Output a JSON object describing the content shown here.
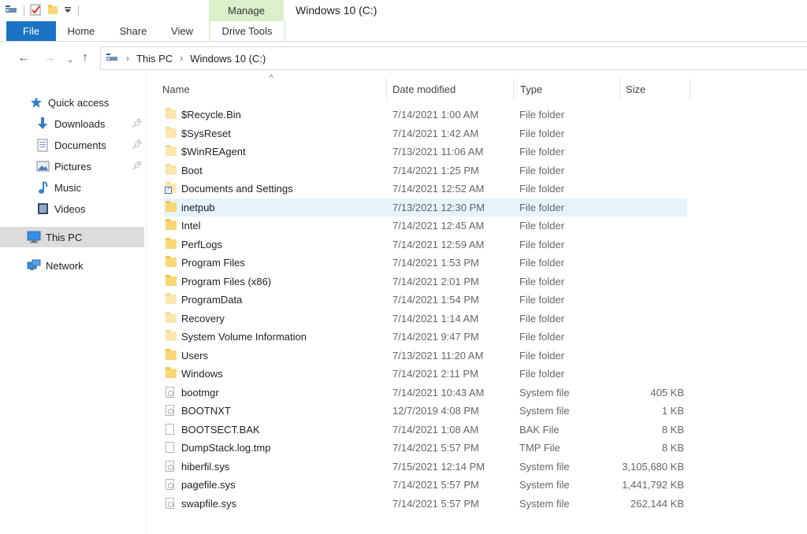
{
  "window": {
    "title": "Windows 10 (C:)"
  },
  "ribbon": {
    "context_group": "Manage",
    "tabs": [
      "File",
      "Home",
      "Share",
      "View",
      "Drive Tools"
    ]
  },
  "nav": {
    "path": [
      "This PC",
      "Windows 10 (C:)"
    ]
  },
  "navpane": {
    "quick_access": "Quick access",
    "downloads": "Downloads",
    "documents": "Documents",
    "pictures": "Pictures",
    "music": "Music",
    "videos": "Videos",
    "this_pc": "This PC",
    "network": "Network"
  },
  "columns": {
    "name": "Name",
    "date": "Date modified",
    "type": "Type",
    "size": "Size"
  },
  "files": [
    {
      "name": "$Recycle.Bin",
      "date": "7/14/2021 1:00 AM",
      "type": "File folder",
      "size": "",
      "icon": "folder-faded-icon"
    },
    {
      "name": "$SysReset",
      "date": "7/14/2021 1:42 AM",
      "type": "File folder",
      "size": "",
      "icon": "folder-faded-icon"
    },
    {
      "name": "$WinREAgent",
      "date": "7/13/2021 11:06 AM",
      "type": "File folder",
      "size": "",
      "icon": "folder-faded-icon"
    },
    {
      "name": "Boot",
      "date": "7/14/2021 1:25 PM",
      "type": "File folder",
      "size": "",
      "icon": "folder-faded-icon"
    },
    {
      "name": "Documents and Settings",
      "date": "7/14/2021 12:52 AM",
      "type": "File folder",
      "size": "",
      "icon": "folder-shortcut-icon"
    },
    {
      "name": "inetpub",
      "date": "7/13/2021 12:30 PM",
      "type": "File folder",
      "size": "",
      "icon": "folder-icon"
    },
    {
      "name": "Intel",
      "date": "7/14/2021 12:45 AM",
      "type": "File folder",
      "size": "",
      "icon": "folder-icon"
    },
    {
      "name": "PerfLogs",
      "date": "7/14/2021 12:59 AM",
      "type": "File folder",
      "size": "",
      "icon": "folder-icon"
    },
    {
      "name": "Program Files",
      "date": "7/14/2021 1:53 PM",
      "type": "File folder",
      "size": "",
      "icon": "folder-icon"
    },
    {
      "name": "Program Files (x86)",
      "date": "7/14/2021 2:01 PM",
      "type": "File folder",
      "size": "",
      "icon": "folder-icon"
    },
    {
      "name": "ProgramData",
      "date": "7/14/2021 1:54 PM",
      "type": "File folder",
      "size": "",
      "icon": "folder-faded-icon"
    },
    {
      "name": "Recovery",
      "date": "7/14/2021 1:14 AM",
      "type": "File folder",
      "size": "",
      "icon": "folder-faded-icon"
    },
    {
      "name": "System Volume Information",
      "date": "7/14/2021 9:47 PM",
      "type": "File folder",
      "size": "",
      "icon": "folder-faded-icon"
    },
    {
      "name": "Users",
      "date": "7/13/2021 11:20 AM",
      "type": "File folder",
      "size": "",
      "icon": "folder-icon"
    },
    {
      "name": "Windows",
      "date": "7/14/2021 2:11 PM",
      "type": "File folder",
      "size": "",
      "icon": "folder-icon"
    },
    {
      "name": "bootmgr",
      "date": "7/14/2021 10:43 AM",
      "type": "System file",
      "size": "405 KB",
      "icon": "system-file-icon"
    },
    {
      "name": "BOOTNXT",
      "date": "12/7/2019 4:08 PM",
      "type": "System file",
      "size": "1 KB",
      "icon": "system-file-icon"
    },
    {
      "name": "BOOTSECT.BAK",
      "date": "7/14/2021 1:08 AM",
      "type": "BAK File",
      "size": "8 KB",
      "icon": "file-icon"
    },
    {
      "name": "DumpStack.log.tmp",
      "date": "7/14/2021 5:57 PM",
      "type": "TMP File",
      "size": "8 KB",
      "icon": "file-icon"
    },
    {
      "name": "hiberfil.sys",
      "date": "7/15/2021 12:14 PM",
      "type": "System file",
      "size": "3,105,680 KB",
      "icon": "system-file-icon"
    },
    {
      "name": "pagefile.sys",
      "date": "7/14/2021 5:57 PM",
      "type": "System file",
      "size": "1,441,792 KB",
      "icon": "system-file-icon"
    },
    {
      "name": "swapfile.sys",
      "date": "7/14/2021 5:57 PM",
      "type": "System file",
      "size": "262,144 KB",
      "icon": "system-file-icon"
    }
  ],
  "selected_file": "inetpub",
  "colors": {
    "file_tab": "#1a73c4",
    "manage_tab": "#d9f0c8",
    "selection": "#e5f3fb",
    "folder": "#f8d775"
  }
}
